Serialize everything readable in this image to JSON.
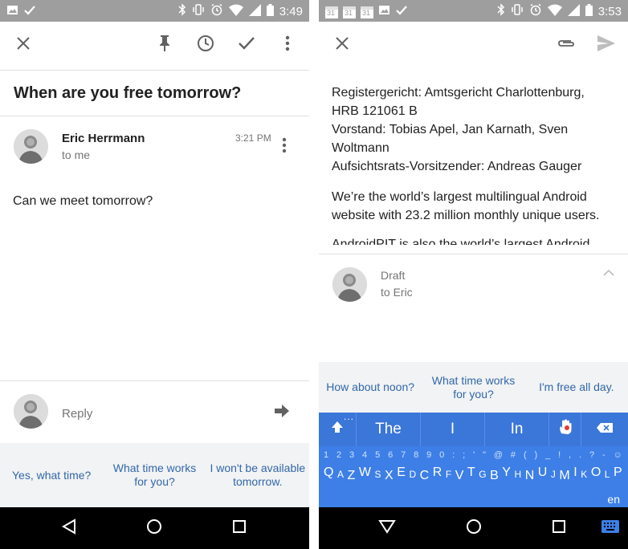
{
  "left": {
    "status": {
      "time": "3:49"
    },
    "subject": "When are you free tomorrow?",
    "message": {
      "sender": "Eric Herrmann",
      "recipient": "to me",
      "time": "3:21 PM",
      "body": "Can we meet tomorrow?"
    },
    "reply_placeholder": "Reply",
    "smart_replies": [
      "Yes, what time?",
      "What time works for you?",
      "I won't be available tomorrow."
    ]
  },
  "right": {
    "status": {
      "time": "3:53"
    },
    "status_dates": [
      "31",
      "31",
      "31"
    ],
    "paragraph1": [
      "Registergericht: Amtsgericht Charlottenburg,",
      "HRB 121061 B",
      "Vorstand: Tobias Apel, Jan Karnath, Sven",
      "Woltmann",
      "Aufsichtsrats-Vorsitzender: Andreas Gauger"
    ],
    "paragraph2": [
      "We’re the world’s largest multilingual Android",
      "website with 23.2 million monthly unique users."
    ],
    "paragraph3_cut": "AndroidPIT is also the world’s largest Android",
    "draft": {
      "label": "Draft",
      "recipient": "to Eric"
    },
    "smart_replies": [
      "How about noon?",
      "What time works for you?",
      "I'm free all day."
    ],
    "keyboard": {
      "suggestions": [
        "The",
        "I",
        "In"
      ],
      "more": "...",
      "number_row": [
        "1",
        "2",
        "3",
        "4",
        "5",
        "6",
        "7",
        "8",
        "9",
        "0",
        ":",
        ";",
        "'",
        "\"",
        "@",
        "#",
        "(",
        ")",
        "_",
        "!",
        ",",
        ".",
        "?",
        "-",
        "☺"
      ],
      "letter_row": [
        "Q",
        "A",
        "Z",
        "W",
        "S",
        "X",
        "E",
        "D",
        "C",
        "R",
        "F",
        "V",
        "T",
        "G",
        "B",
        "Y",
        "H",
        "N",
        "U",
        "J",
        "M",
        "I",
        "K",
        "O",
        "L",
        "P"
      ],
      "language": "en"
    }
  },
  "colors": {
    "accent": "#3367a9",
    "keyboard": "#3d7fe6",
    "statusbar": "#9e9e9e"
  }
}
